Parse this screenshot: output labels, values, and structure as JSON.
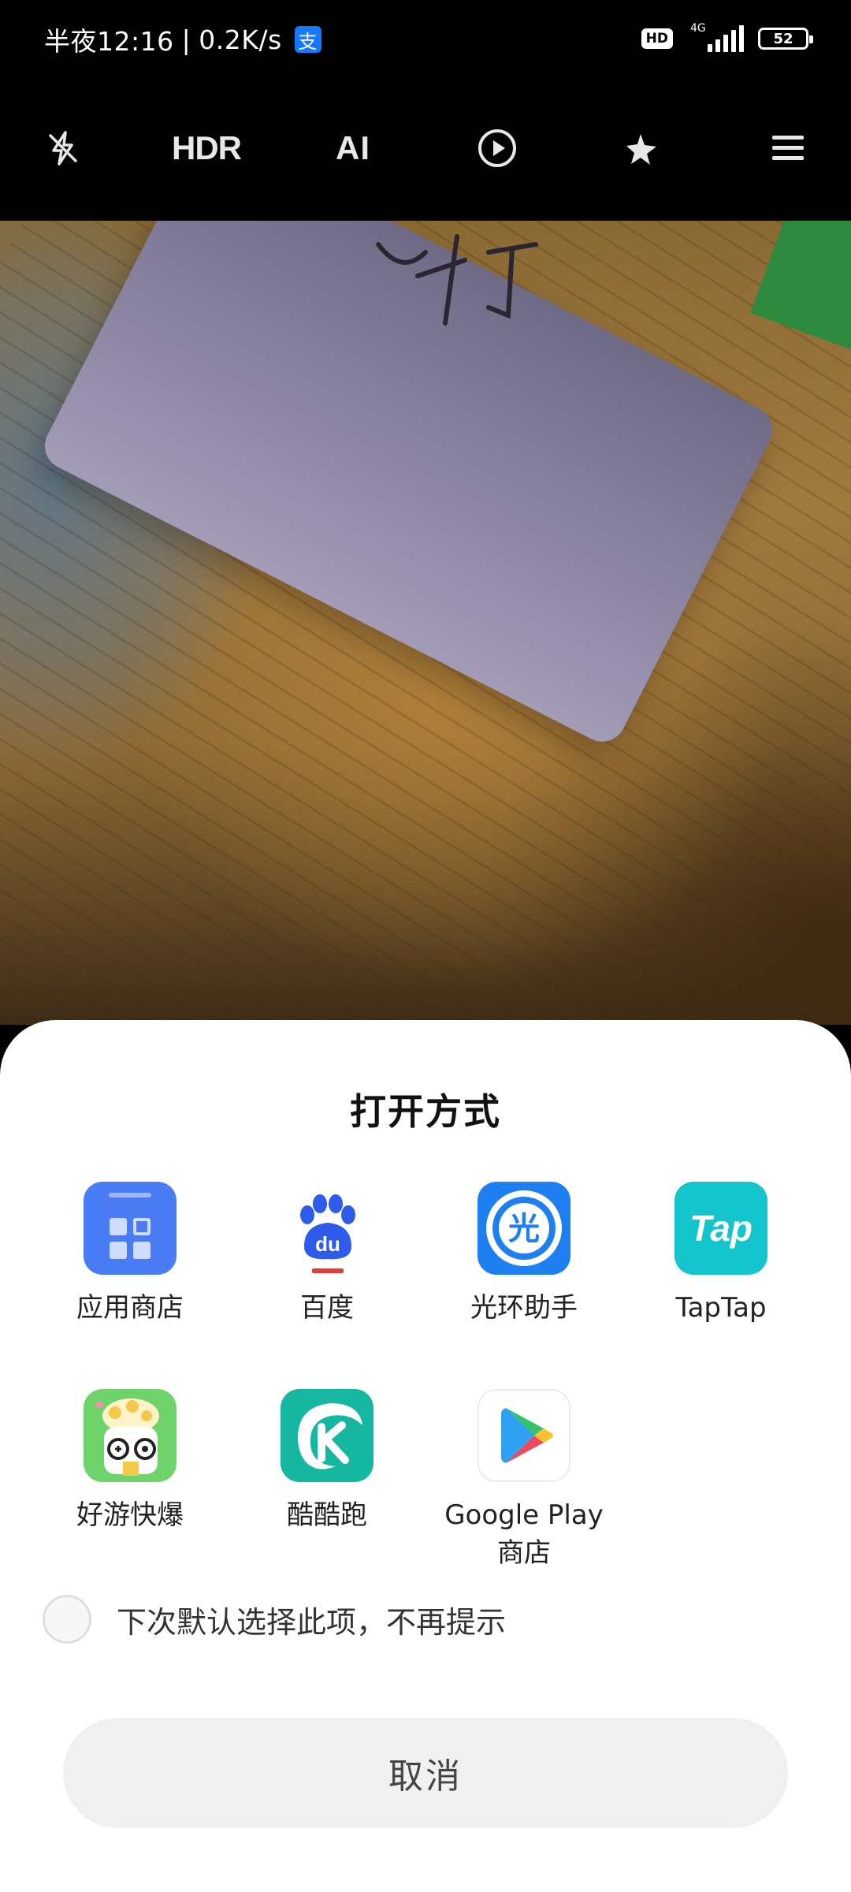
{
  "status_bar": {
    "time": "半夜12:16",
    "separator": "|",
    "speed": "0.2K/s",
    "alipay_icon": "alipay-icon",
    "hd": "HD",
    "network": "4G",
    "battery": "52"
  },
  "camera_toolbar": {
    "flash_icon": "flash-off-icon",
    "hdr": "HDR",
    "ai": "AI",
    "live_icon": "live-photo-icon",
    "beauty_icon": "beauty-icon",
    "menu_icon": "menu-icon"
  },
  "sheet": {
    "title": "打开方式",
    "apps": [
      {
        "label": "应用商店",
        "icon": "app-store-icon",
        "color": "#4a7cf6"
      },
      {
        "label": "百度",
        "icon": "baidu-icon",
        "color": "#2f5bea"
      },
      {
        "label": "光环助手",
        "icon": "guanghuan-icon",
        "color": "#1e7ff0"
      },
      {
        "label": "TapTap",
        "icon": "taptap-icon",
        "color": "#15c5ce",
        "text": "Tap"
      },
      {
        "label": "好游快爆",
        "icon": "haoyou-kuaibao-icon",
        "color": "#6ed36b"
      },
      {
        "label": "酷酷跑",
        "icon": "kukupao-icon",
        "color": "#16b7a0"
      },
      {
        "label": "Google Play",
        "label2": "商店",
        "icon": "google-play-icon",
        "color": "#ffffff"
      }
    ],
    "remember_label": "下次默认选择此项，不再提示",
    "remember_checked": false,
    "cancel_label": "取消"
  }
}
